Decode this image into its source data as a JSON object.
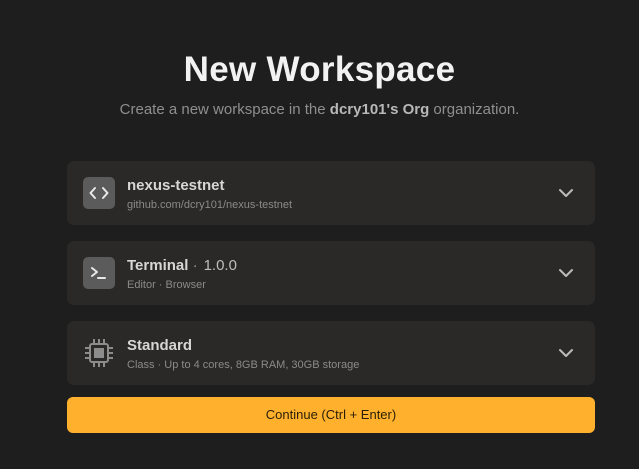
{
  "header": {
    "title": "New Workspace",
    "subtitle_prefix": "Create a new workspace in the ",
    "org_name": "dcry101's Org",
    "subtitle_suffix": " organization."
  },
  "repository": {
    "name": "nexus-testnet",
    "url": "github.com/dcry101/nexus-testnet",
    "icon": "code-brackets-icon"
  },
  "editor": {
    "name": "Terminal",
    "separator": " ·",
    "version": "1.0.0",
    "detail": "Editor · Browser",
    "icon": "terminal-icon"
  },
  "workspace_class": {
    "name": "Standard",
    "detail": "Class · Up to 4 cores, 8GB RAM, 30GB storage",
    "icon": "cpu-chip-icon"
  },
  "actions": {
    "continue_label": "Continue (Ctrl + Enter)"
  },
  "colors": {
    "background": "#1e1e1e",
    "card": "#2a2927",
    "accent": "#ffb12e"
  }
}
